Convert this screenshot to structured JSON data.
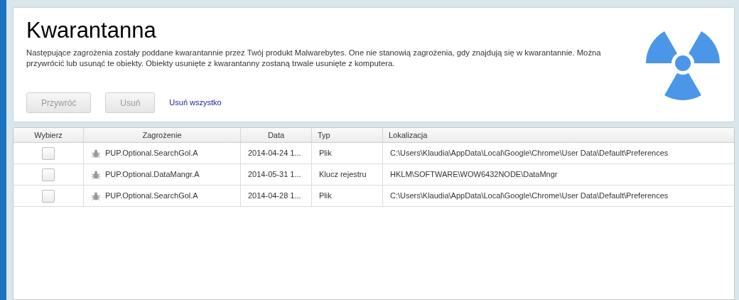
{
  "title": "Kwarantanna",
  "description": "Następujące zagrożenia zostały poddane kwarantannie przez Twój produkt Malwarebytes. One nie stanowią zagrożenia, gdy znajdują się w kwarantannie. Można przywrócić lub usunąć te obiekty. Obiekty usunięte z kwarantanny zostaną trwale usunięte z komputera.",
  "buttons": [
    {
      "label": "Przywróć",
      "disabled": true
    },
    {
      "label": "Usuń",
      "disabled": true
    }
  ],
  "link": "Usuń wszystko",
  "table": {
    "columns": [
      "Wybierz",
      "Zagrożenie",
      "Data",
      "Typ",
      "Lokalizacja"
    ],
    "rows": [
      {
        "checked": false,
        "threat": "PUP.Optional.SearchGol.A",
        "date": "2014-04-24 1...",
        "type": "Plik",
        "location": "C:\\Users\\Klaudia\\AppData\\Local\\Google\\Chrome\\User Data\\Default\\Preferences"
      },
      {
        "checked": false,
        "threat": "PUP.Optional.DataMangr.A",
        "date": "2014-05-31 1...",
        "type": "Klucz rejestru",
        "location": "HKLM\\SOFTWARE\\WOW6432NODE\\DataMngr"
      },
      {
        "checked": false,
        "threat": "PUP.Optional.SearchGol.A",
        "date": "2014-04-28 1...",
        "type": "Plik",
        "location": "C:\\Users\\Klaudia\\AppData\\Local\\Google\\Chrome\\User Data\\Default\\Preferences"
      }
    ]
  }
}
